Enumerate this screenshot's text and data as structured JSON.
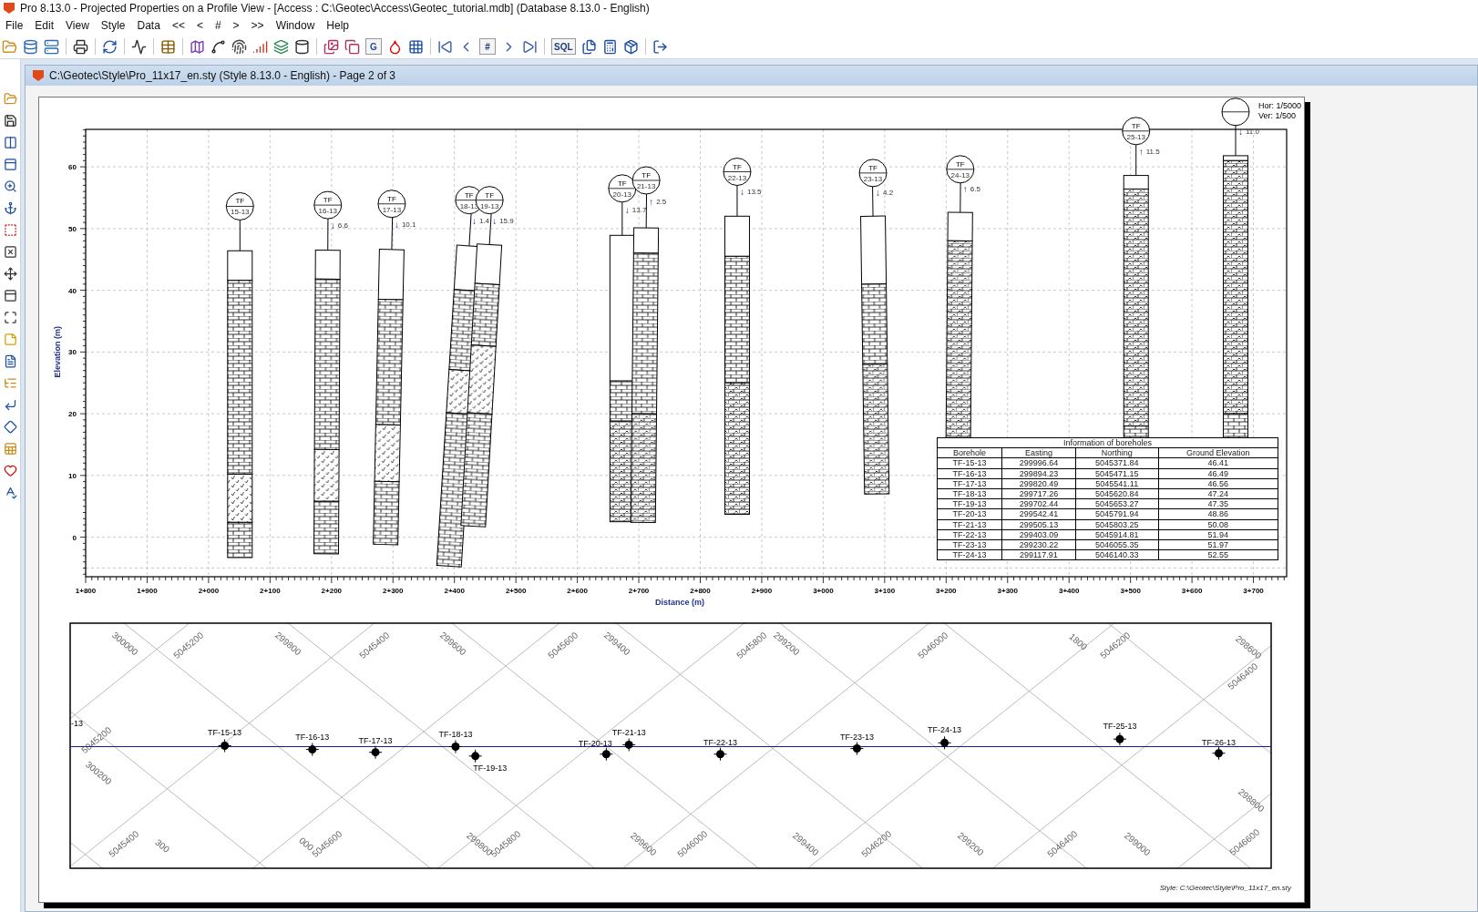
{
  "window": {
    "title": "Pro 8.13.0 - Projected Properties on a Profile View - [Access : C:\\Geotec\\Access\\Geotec_tutorial.mdb] (Database 8.13.0 - English)"
  },
  "menu": [
    {
      "label": "File"
    },
    {
      "label": "Edit"
    },
    {
      "label": "View"
    },
    {
      "label": "Style"
    },
    {
      "label": "Data"
    },
    {
      "label": "<<"
    },
    {
      "label": "<"
    },
    {
      "label": "#"
    },
    {
      "label": ">"
    },
    {
      "label": ">>"
    },
    {
      "label": "Window"
    },
    {
      "label": "Help"
    }
  ],
  "toolbar": {
    "g_button": "G",
    "page_button": "#",
    "sql_button": "SQL"
  },
  "document": {
    "title": "C:\\Geotec\\Style\\Pro_11x17_en.sty (Style 8.13.0 - English) - Page 2 of 3"
  },
  "profile": {
    "scale": [
      "Hor: 1/5000",
      "Ver: 1/500"
    ],
    "y_axis_title": "Elevation (m)",
    "x_axis_title": "Distance (m)",
    "y_ticks": [
      "60",
      "50",
      "40",
      "30",
      "20",
      "10",
      "0"
    ],
    "x_ticks": [
      "1+800",
      "1+900",
      "2+000",
      "2+100",
      "2+200",
      "2+300",
      "2+400",
      "2+500",
      "2+600",
      "2+700",
      "2+800",
      "2+900",
      "3+000",
      "3+100",
      "3+200",
      "3+300",
      "3+400",
      "3+500",
      "3+600",
      "3+700"
    ],
    "boreholes": [
      {
        "prefix": "TF",
        "id": "15-13"
      },
      {
        "prefix": "TF",
        "id": "16-13",
        "arrow": "↓",
        "reading": "6.6"
      },
      {
        "prefix": "TF",
        "id": "17-13",
        "arrow": "↓",
        "reading": "10.1"
      },
      {
        "prefix": "TF",
        "id": "18-13",
        "arrow": "↓",
        "reading": "1.4"
      },
      {
        "prefix": "TF",
        "id": "19-13",
        "arrow": "↓",
        "reading": "15.9"
      },
      {
        "prefix": "TF",
        "id": "20-13",
        "arrow": "↓",
        "reading": "13.7"
      },
      {
        "prefix": "TF",
        "id": "21-13",
        "arrow": "↑",
        "reading": "2.5"
      },
      {
        "prefix": "TF",
        "id": "22-13",
        "arrow": "↓",
        "reading": "13.5"
      },
      {
        "prefix": "TF",
        "id": "23-13",
        "arrow": "↓",
        "reading": "4.2"
      },
      {
        "prefix": "TF",
        "id": "24-13",
        "arrow": "↑",
        "reading": "6.5"
      },
      {
        "prefix": "TF",
        "id": "25-13",
        "arrow": "↑",
        "reading": "11.5"
      },
      {
        "arrow": "↓",
        "reading": "11.0"
      }
    ]
  },
  "table": {
    "title": "Information of boreholes",
    "columns": [
      "Borehole",
      "Easting",
      "Northing",
      "Ground Elevation"
    ],
    "rows": [
      [
        "TF-15-13",
        "299996.64",
        "5045371.84",
        "46.41"
      ],
      [
        "TF-16-13",
        "299894.23",
        "5045471.15",
        "46.49"
      ],
      [
        "TF-17-13",
        "299820.49",
        "5045541.11",
        "46.56"
      ],
      [
        "TF-18-13",
        "299717.26",
        "5045620.84",
        "47.24"
      ],
      [
        "TF-19-13",
        "299702.44",
        "5045653.27",
        "47.35"
      ],
      [
        "TF-20-13",
        "299542.41",
        "5045791.94",
        "48.86"
      ],
      [
        "TF-21-13",
        "299505.13",
        "5045803.25",
        "50.08"
      ],
      [
        "TF-22-13",
        "299403.09",
        "5045914.81",
        "51.94"
      ],
      [
        "TF-23-13",
        "299230.22",
        "5046055.35",
        "51.97"
      ],
      [
        "TF-24-13",
        "299117.91",
        "5046140.33",
        "52.55"
      ]
    ]
  },
  "map": {
    "edge_label": "-13",
    "points": [
      {
        "label": "TF-15-13"
      },
      {
        "label": "TF-16-13"
      },
      {
        "label": "TF-17-13"
      },
      {
        "label": "TF-18-13"
      },
      {
        "label": "TF-19-13"
      },
      {
        "label": "TF-20-13"
      },
      {
        "label": "TF-21-13"
      },
      {
        "label": "TF-22-13"
      },
      {
        "label": "TF-23-13"
      },
      {
        "label": "TF-24-13"
      },
      {
        "label": "TF-25-13"
      },
      {
        "label": "TF-26-13"
      }
    ],
    "grid_labels": [
      "300000",
      "5045200",
      "299800",
      "5045400",
      "299600",
      "5045600",
      "299400",
      "5045800",
      "299200",
      "5046000",
      "1800",
      "5046200",
      "298600",
      "5045200",
      "300200",
      "5046400",
      "298800",
      "5045400",
      "300",
      "000",
      "5045600",
      "299800",
      "5045800",
      "299600",
      "5046000",
      "299400",
      "5046200",
      "299200",
      "5046400",
      "299000",
      "5046600"
    ]
  },
  "footer": "Style: C:\\Geotec\\Style\\Pro_11x17_en.sty"
}
